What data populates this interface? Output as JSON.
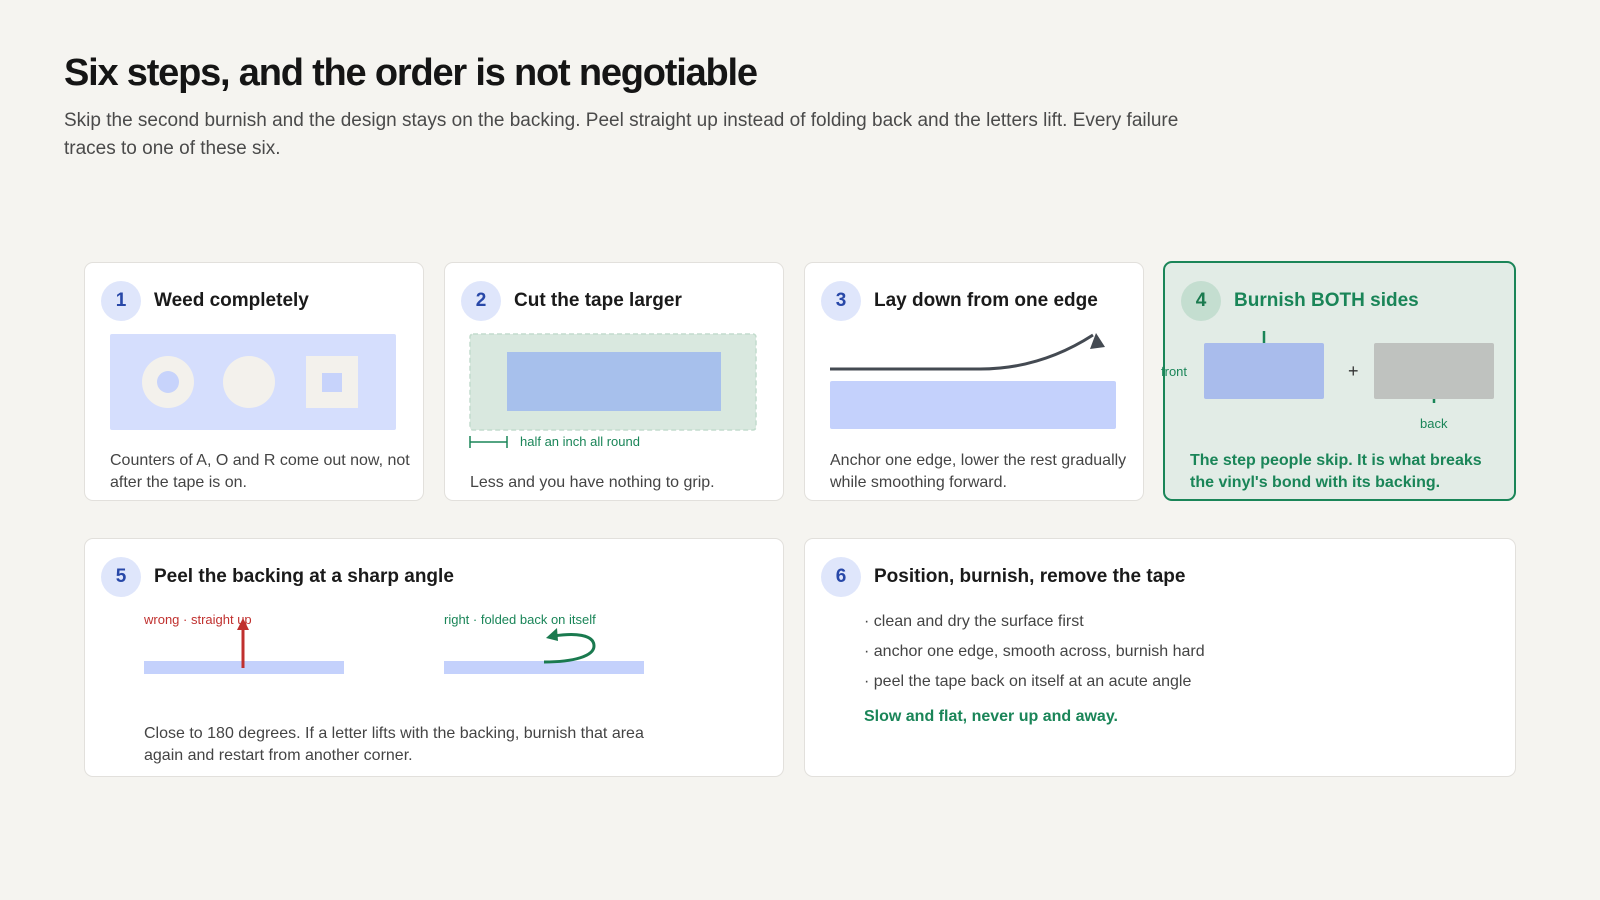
{
  "header": {
    "title": "Six steps, and the order is not negotiable",
    "subtitle": "Skip the second burnish and the design stays on the backing. Peel straight up instead of folding back and the letters lift. Every failure traces to one of these six."
  },
  "steps": [
    {
      "number": "1",
      "title": "Weed completely",
      "description": "Counters of A, O and R come out now, not after the tape is on."
    },
    {
      "number": "2",
      "title": "Cut the tape larger",
      "description": "Less and you have nothing to grip.",
      "margin_label": "half an inch all round"
    },
    {
      "number": "3",
      "title": "Lay down from one edge",
      "description": "Anchor one edge, lower the rest gradually while smoothing forward."
    },
    {
      "number": "4",
      "title": "Burnish BOTH sides",
      "description": "The step people skip. It is what breaks the vinyl's bond with its backing.",
      "front_label": "front",
      "back_label": "back",
      "plus": "+"
    },
    {
      "number": "5",
      "title": "Peel the backing at a sharp angle",
      "description": "Close to 180 degrees. If a letter lifts with the backing, burnish that area again and restart from another corner.",
      "wrong_label": "wrong · straight up",
      "right_label": "right · folded back on itself"
    },
    {
      "number": "6",
      "title": "Position, burnish, remove the tape",
      "bullets": [
        "· clean and dry the surface first",
        "· anchor one edge, smooth across, burnish hard",
        "· peel the tape back on itself at an acute angle"
      ],
      "note": "Slow and flat, never up and away."
    }
  ],
  "colors": {
    "accent_green": "#1a8558",
    "wrong_red": "#c0302e",
    "tape_blue": "#c4d1fc",
    "page_bg": "#f5f4f0"
  }
}
